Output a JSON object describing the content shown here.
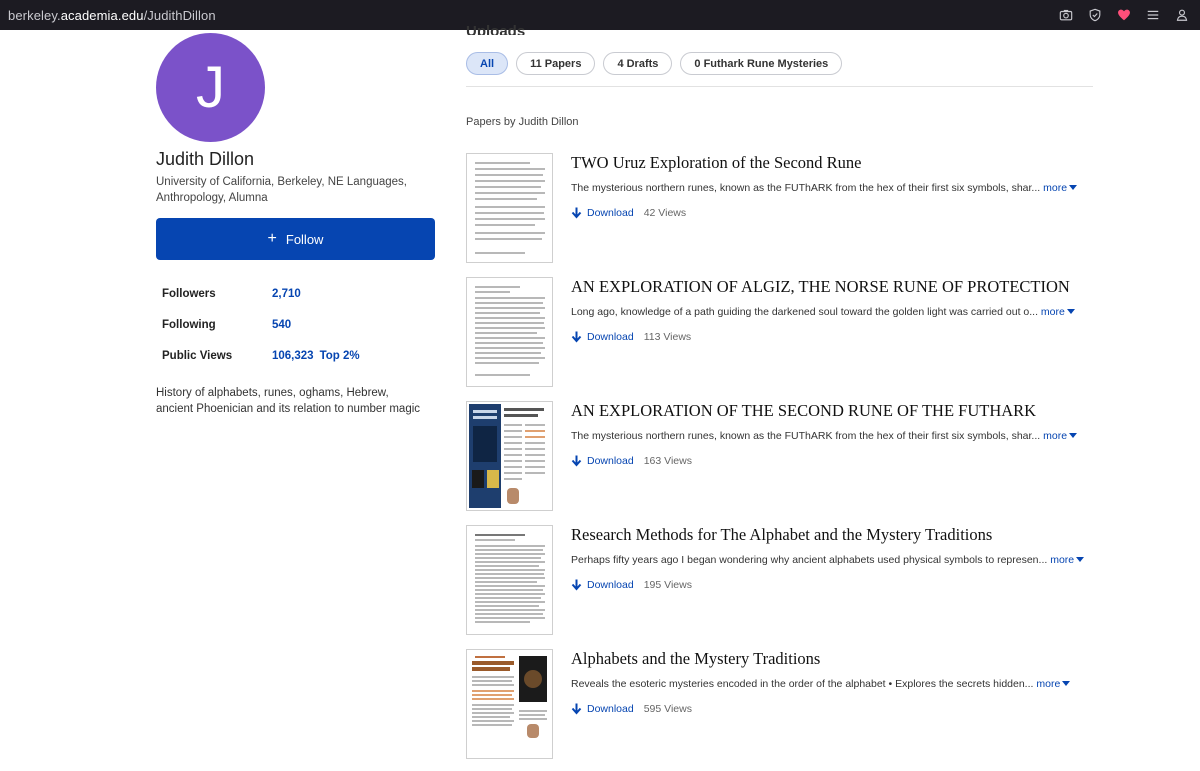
{
  "browser": {
    "url_prefix": "berkeley.",
    "url_host": "academia.edu",
    "url_path": "/JudithDillon",
    "icons": [
      "camera-icon",
      "shield-icon",
      "heart-icon",
      "menu-icon",
      "account-icon"
    ]
  },
  "profile": {
    "avatar_letter": "J",
    "name": "Judith Dillon",
    "affiliation": "University of California, Berkeley, NE Languages, Anthropology, Alumna",
    "follow_label": "Follow",
    "stats": [
      {
        "label": "Followers",
        "value": "2,710",
        "extra": ""
      },
      {
        "label": "Following",
        "value": "540",
        "extra": ""
      },
      {
        "label": "Public Views",
        "value": "106,323",
        "extra": "Top 2%"
      }
    ],
    "bio": "History of alphabets, runes, oghams, Hebrew, ancient Phoenician and its relation to number magic"
  },
  "uploads": {
    "title": "Uploads",
    "filters": [
      {
        "label": "All",
        "active": true
      },
      {
        "label": "11 Papers",
        "active": false
      },
      {
        "label": "4 Drafts",
        "active": false
      },
      {
        "label": "0 Futhark Rune Mysteries",
        "active": false
      }
    ],
    "papers_heading": "Papers by Judith Dillon",
    "download_label": "Download",
    "more_label": "more",
    "papers": [
      {
        "title": "TWO Uruz Exploration of the Second Rune",
        "abstract": "The mysterious northern runes, known as the FUThARK from the hex of their first six symbols, shar...",
        "views": "42 Views"
      },
      {
        "title": "AN EXPLORATION OF ALGIZ, THE NORSE RUNE OF PROTECTION",
        "abstract": "Long ago, knowledge of a path guiding the darkened soul toward the golden light was carried out o...",
        "views": "113 Views"
      },
      {
        "title": "AN EXPLORATION OF THE SECOND RUNE OF THE FUTHARK",
        "abstract": "The mysterious northern runes, known as the FUThARK from the hex of their first six symbols, shar...",
        "views": "163 Views"
      },
      {
        "title": "Research Methods for The Alphabet and the Mystery Traditions",
        "abstract": "Perhaps fifty years ago I began wondering why ancient alphabets used physical symbols to represen...",
        "views": "195 Views"
      },
      {
        "title": "Alphabets and the Mystery Traditions",
        "abstract": "Reveals the esoteric mysteries encoded in the order of the alphabet • Explores the secrets hidden...",
        "views": "595 Views"
      }
    ]
  }
}
